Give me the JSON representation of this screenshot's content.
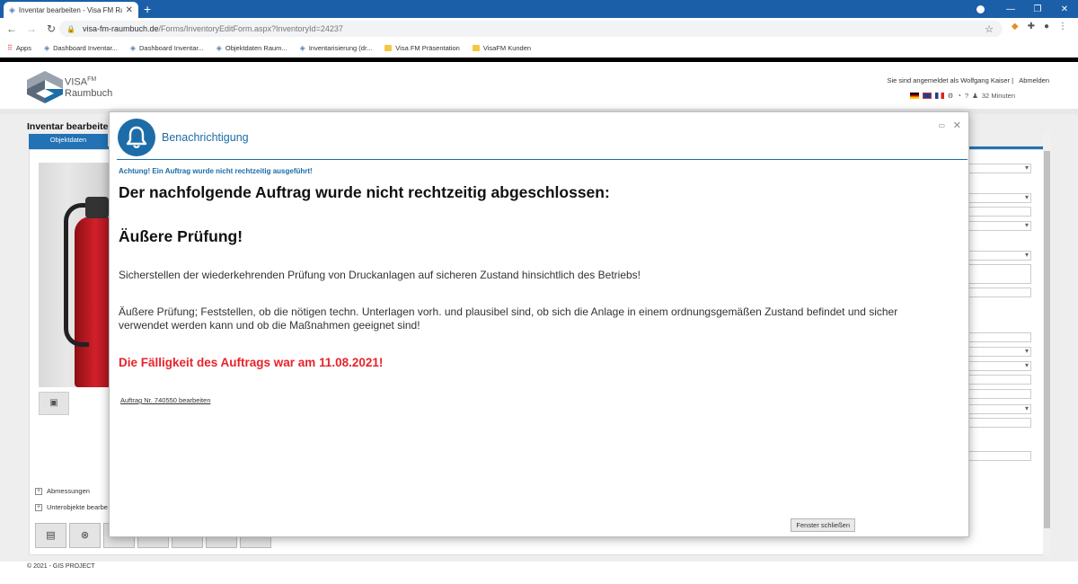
{
  "browser": {
    "tab_title": "Inventar bearbeiten - Visa FM Ra",
    "url_host": "visa-fm-raumbuch.de",
    "url_path": "/Forms/InventoryEditForm.aspx?InventoryId=24237",
    "bookmarks": [
      {
        "label": "Apps",
        "icon": "apps-icon"
      },
      {
        "label": "Dashboard Inventar...",
        "icon": "visa-icon"
      },
      {
        "label": "Dashboard Inventar...",
        "icon": "visa-icon"
      },
      {
        "label": "Objektdaten Raum...",
        "icon": "visa-icon"
      },
      {
        "label": "Inventarisierung (dr...",
        "icon": "visa-icon"
      },
      {
        "label": "Visa FM Präsentation",
        "icon": "folder-icon"
      },
      {
        "label": "VisaFM Kunden",
        "icon": "folder-icon"
      }
    ]
  },
  "header": {
    "logo_line1": "VISA",
    "logo_sup": "FM",
    "logo_line2": "Raumbuch",
    "login_text": "Sie sind angemeldet als Wolfgang Kaiser |",
    "logout_label": "Abmelden",
    "session_time": "32 Minuten"
  },
  "page": {
    "title": "Inventar bearbeiten",
    "tab_objektdaten": "Objektdaten",
    "expander_abmessungen": "Abmessungen",
    "expander_unterobjekte": "Unterobjekte bearbe",
    "footer": "© 2021 - GIS PROJECT"
  },
  "modal": {
    "title": "Benachrichtigung",
    "warning": "Achtung! Ein Auftrag wurde nicht rechtzeitig ausgeführt!",
    "headline": "Der nachfolgende Auftrag wurde nicht rechtzeitig abgeschlossen:",
    "task_name": "Äußere Prüfung!",
    "description_1": "Sicherstellen der wiederkehrenden Prüfung von Druckanlagen auf sicheren Zustand hinsichtlich des Betriebs!",
    "description_2": "Äußere Prüfung; Feststellen, ob die nötigen techn. Unterlagen vorh. und plausibel sind, ob sich die Anlage in einem ordnungsgemäßen Zustand befindet und sicher verwendet werden kann und ob die Maßnahmen geeignet sind!",
    "due_text": "Die Fälligkeit des Auftrags war am 11.08.2021!",
    "edit_link": "Auftrag Nr. 740550 bearbeiten",
    "close_button": "Fenster schließen"
  },
  "colors": {
    "accent": "#1c6ca7",
    "alert": "#e8232a",
    "browser_frame": "#1b5fa8"
  }
}
